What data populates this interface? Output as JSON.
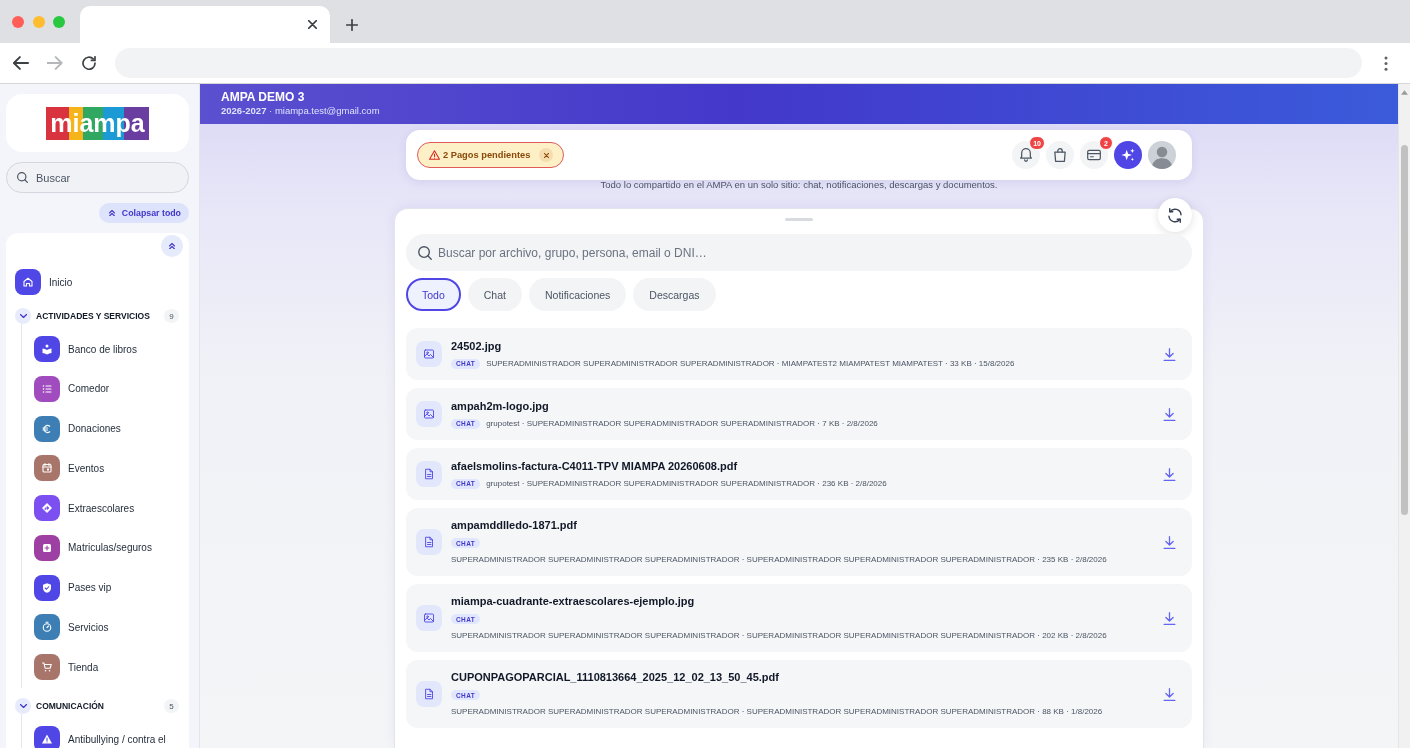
{
  "browser": {
    "nav": [
      {
        "kind": "back",
        "disabled": false
      },
      {
        "kind": "forward",
        "disabled": true
      },
      {
        "kind": "reload",
        "disabled": false
      }
    ]
  },
  "sidebar": {
    "logo": "miampa",
    "search": {
      "placeholder": "Buscar"
    },
    "collapse_all": "Colapsar todo",
    "home": {
      "label": "Inicio",
      "kind": "house",
      "color": "#5048e6"
    },
    "sections": [
      {
        "title": "ACTIVIDADES Y SERVICIOS",
        "count": "9",
        "expanded": true,
        "items": [
          {
            "label": "Banco de libros",
            "kind": "book",
            "color": "#4f46e5"
          },
          {
            "label": "Comedor",
            "kind": "list",
            "color": "#a04cbf"
          },
          {
            "label": "Donaciones",
            "kind": "euro",
            "color": "#3d7fb5"
          },
          {
            "label": "Eventos",
            "kind": "calendar",
            "color": "#a8756b"
          },
          {
            "label": "Extraescolares",
            "kind": "route",
            "color": "#7b4ff0"
          },
          {
            "label": "Matriculas/seguros",
            "kind": "plus",
            "color": "#9d3fa3"
          },
          {
            "label": "Pases vip",
            "kind": "shield",
            "color": "#4f46e5"
          },
          {
            "label": "Servicios",
            "kind": "timer",
            "color": "#3d7fb5"
          },
          {
            "label": "Tienda",
            "kind": "cart",
            "color": "#a8756b"
          }
        ]
      },
      {
        "title": "COMUNICACIÓN",
        "count": "5",
        "expanded": true,
        "items": [
          {
            "label": "Antibullying / contra el",
            "kind": "warning",
            "color": "#4f46e5"
          }
        ]
      }
    ]
  },
  "header": {
    "title": "AMPA DEMO 3",
    "subtitle": "**2026-2027** · miampa.test@gmail.com"
  },
  "topbar": {
    "alert": "2 Pagos pendientes",
    "buttons": [
      {
        "kind": "bell",
        "badge": "10"
      },
      {
        "kind": "bag"
      },
      {
        "kind": "card",
        "badge": "2"
      },
      {
        "kind": "sparkle"
      },
      {
        "kind": "avatar"
      }
    ]
  },
  "intro": "Todo lo compartido en el AMPA en un solo sitio: chat, notificaciones, descargas y documentos.",
  "panel": {
    "search": {
      "placeholder": "Buscar por archivo, grupo, persona, email o DNI…"
    },
    "tabs": [
      {
        "label": "Todo",
        "selected": true
      },
      {
        "label": "Chat",
        "selected": false
      },
      {
        "label": "Notificaciones",
        "selected": false
      },
      {
        "label": "Descargas",
        "selected": false
      }
    ],
    "files": [
      {
        "name": "24502.jpg",
        "kind": "image",
        "tag": "CHAT",
        "meta": "SUPERADMINISTRADOR SUPERADMINISTRADOR SUPERADMINISTRADOR · MIAMPATEST2 MIAMPATEST MIAMPATEST · 33 KB · 15/8/2026"
      },
      {
        "name": "ampah2m-logo.jpg",
        "kind": "image",
        "tag": "CHAT",
        "meta": "grupotest · SUPERADMINISTRADOR SUPERADMINISTRADOR SUPERADMINISTRADOR · 7 KB · 2/8/2026"
      },
      {
        "name": "afaelsmolins-factura-C4011-TPV MIAMPA 20260608.pdf",
        "kind": "document",
        "tag": "CHAT",
        "meta": "grupotest · SUPERADMINISTRADOR SUPERADMINISTRADOR SUPERADMINISTRADOR · 236 KB · 2/8/2026"
      },
      {
        "name": "ampamddlledo-1871.pdf",
        "kind": "document",
        "tag": "CHAT",
        "meta": "SUPERADMINISTRADOR SUPERADMINISTRADOR SUPERADMINISTRADOR · SUPERADMINISTRADOR SUPERADMINISTRADOR SUPERADMINISTRADOR · 235 KB · 2/8/2026"
      },
      {
        "name": "miampa-cuadrante-extraescolares-ejemplo.jpg",
        "kind": "image",
        "tag": "CHAT",
        "meta": "SUPERADMINISTRADOR SUPERADMINISTRADOR SUPERADMINISTRADOR · SUPERADMINISTRADOR SUPERADMINISTRADOR SUPERADMINISTRADOR · 202 KB · 2/8/2026"
      },
      {
        "name": "CUPONPAGOPARCIAL_1110813664_2025_12_02_13_50_45.pdf",
        "kind": "document",
        "tag": "CHAT",
        "meta": "SUPERADMINISTRADOR SUPERADMINISTRADOR SUPERADMINISTRADOR · SUPERADMINISTRADOR SUPERADMINISTRADOR SUPERADMINISTRADOR · 88 KB · 1/8/2026"
      }
    ]
  }
}
